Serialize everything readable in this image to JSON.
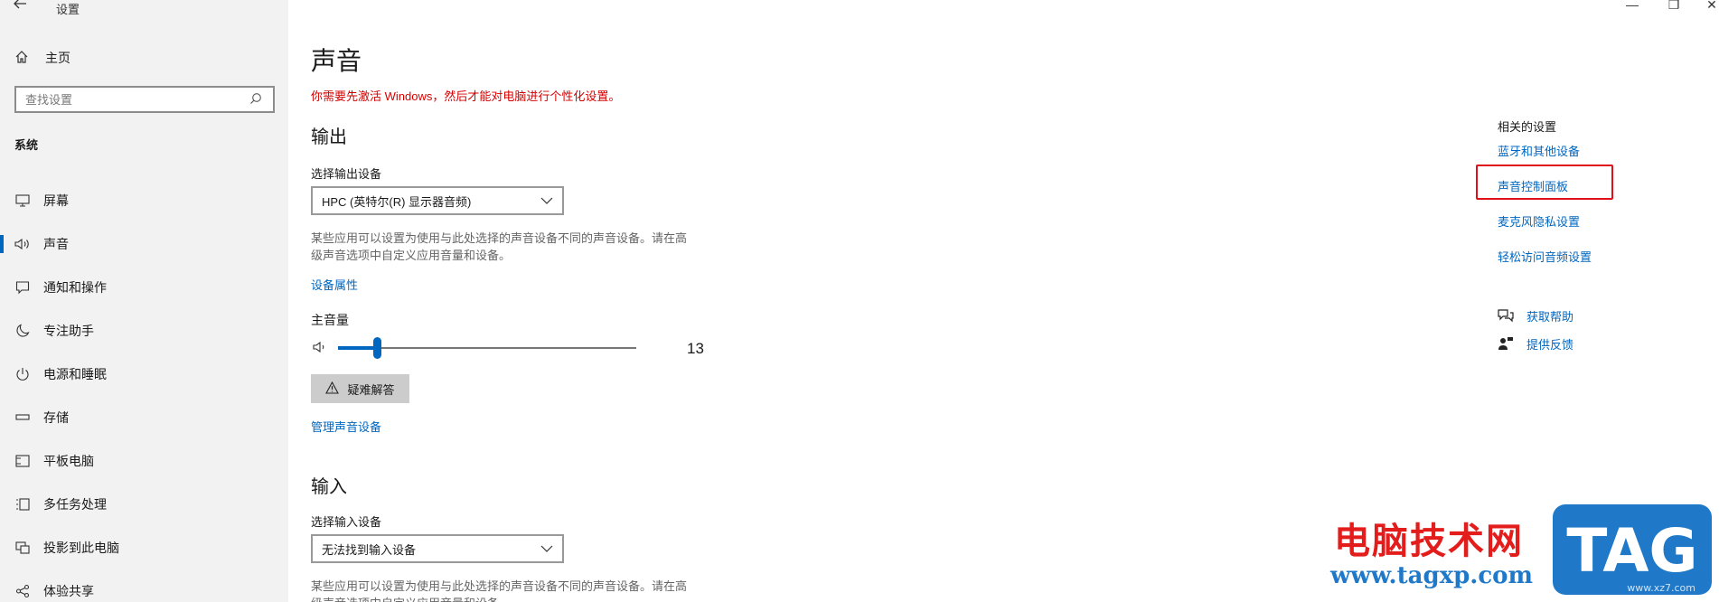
{
  "window": {
    "title": "设置",
    "minimize": "—",
    "restore": "❐",
    "close": "✕"
  },
  "sidebar": {
    "home_label": "主页",
    "search_placeholder": "查找设置",
    "section_label": "系统",
    "items": [
      {
        "label": "屏幕",
        "icon": "monitor-icon"
      },
      {
        "label": "声音",
        "icon": "speaker-icon",
        "active": true
      },
      {
        "label": "通知和操作",
        "icon": "notification-icon"
      },
      {
        "label": "专注助手",
        "icon": "moon-icon"
      },
      {
        "label": "电源和睡眠",
        "icon": "power-icon"
      },
      {
        "label": "存储",
        "icon": "storage-icon"
      },
      {
        "label": "平板电脑",
        "icon": "tablet-icon"
      },
      {
        "label": "多任务处理",
        "icon": "multitask-icon"
      },
      {
        "label": "投影到此电脑",
        "icon": "project-icon"
      },
      {
        "label": "体验共享",
        "icon": "share-icon"
      }
    ]
  },
  "main": {
    "title": "声音",
    "activation_warning": "你需要先激活 Windows，然后才能对电脑进行个性化设置。",
    "output": {
      "heading": "输出",
      "select_label": "选择输出设备",
      "selected_device": "HPC (英特尔(R) 显示器音频)",
      "description_line1": "某些应用可以设置为使用与此处选择的声音设备不同的声音设备。请在高",
      "description_line2": "级声音选项中自定义应用音量和设备。",
      "device_properties_link": "设备属性",
      "master_volume_label": "主音量",
      "volume_value": "13",
      "volume_fraction": 0.13,
      "troubleshoot_label": "疑难解答",
      "manage_devices_link": "管理声音设备"
    },
    "input": {
      "heading": "输入",
      "select_label": "选择输入设备",
      "selected_device": "无法找到输入设备",
      "description_line1": "某些应用可以设置为使用与此处选择的声音设备不同的声音设备。请在高",
      "description_line2": "级声音选项中自定义应用音量和设备。"
    }
  },
  "related": {
    "title": "相关的设置",
    "links": [
      "蓝牙和其他设备",
      "声音控制面板",
      "麦克风隐私设置",
      "轻松访问音频设置"
    ],
    "help_label": "获取帮助",
    "feedback_label": "提供反馈"
  },
  "watermark": {
    "text": "电脑技术网",
    "url": "www.tagxp.com",
    "logo_text": "TAG",
    "logo_sub": "www.xz7.com"
  },
  "colors": {
    "accent": "#0067c0",
    "warning": "#d40000",
    "highlight": "#e0101a",
    "sidebar_bg": "#f2f2f2"
  }
}
